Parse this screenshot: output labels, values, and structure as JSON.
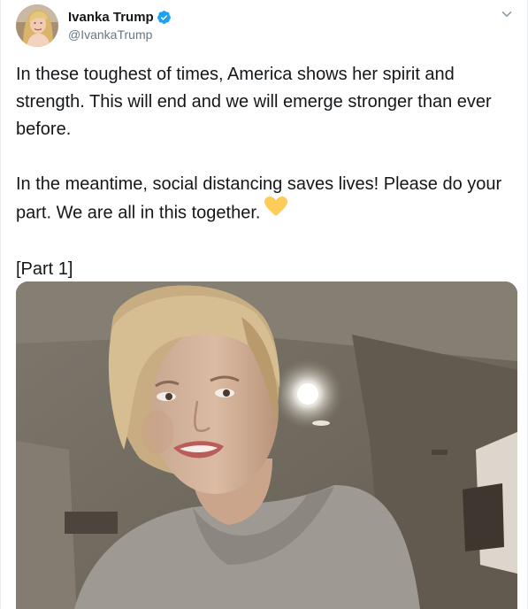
{
  "user": {
    "display_name": "Ivanka Trump",
    "handle": "@IvankaTrump",
    "verified_icon": "verified-badge-icon",
    "avatar_icon": "profile-avatar"
  },
  "menu": {
    "icon": "chevron-down-icon"
  },
  "tweet": {
    "paragraph_1": "In these toughest of times, America shows her spirit and strength. This will end and we will emerge stronger than ever before.",
    "paragraph_2": "In the meantime, social distancing saves lives! Please do your part. We are all in this together.",
    "paragraph_2_emoji": "yellow-heart-icon",
    "paragraph_3": "[Part 1]"
  },
  "media": {
    "type": "video-thumbnail"
  },
  "colors": {
    "text_primary": "#14171a",
    "text_secondary": "#657786",
    "verified_blue": "#1da1f2",
    "heart_yellow": "#fdcb58",
    "border": "#e6ecf0"
  }
}
